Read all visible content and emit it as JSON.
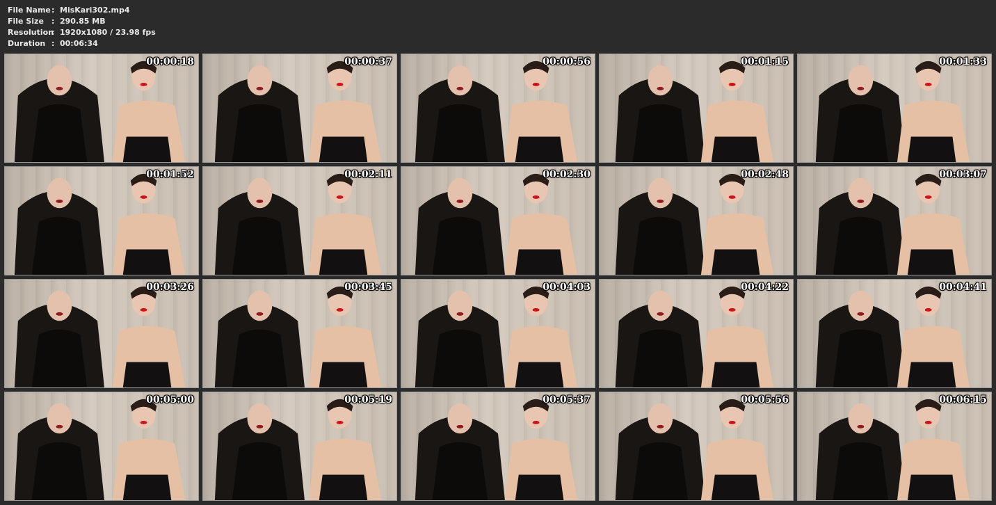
{
  "file_info": {
    "name_label": "File Name",
    "name_value": "MisKari302.mp4",
    "size_label": "File Size",
    "size_value": "290.85 MB",
    "resolution_label": "Resolution",
    "resolution_value": "1920x1080 / 23.98 fps",
    "duration_label": "Duration",
    "duration_value": "00:06:34",
    "separator": ":"
  },
  "thumbnails": [
    {
      "time": "00:00:18"
    },
    {
      "time": "00:00:37"
    },
    {
      "time": "00:00:56"
    },
    {
      "time": "00:01:15"
    },
    {
      "time": "00:01:33"
    },
    {
      "time": "00:01:52"
    },
    {
      "time": "00:02:11"
    },
    {
      "time": "00:02:30"
    },
    {
      "time": "00:02:48"
    },
    {
      "time": "00:03:07"
    },
    {
      "time": "00:03:26"
    },
    {
      "time": "00:03:45"
    },
    {
      "time": "00:04:03"
    },
    {
      "time": "00:04:22"
    },
    {
      "time": "00:04:41"
    },
    {
      "time": "00:05:00"
    },
    {
      "time": "00:05:19"
    },
    {
      "time": "00:05:37"
    },
    {
      "time": "00:05:56"
    },
    {
      "time": "00:06:15"
    }
  ]
}
